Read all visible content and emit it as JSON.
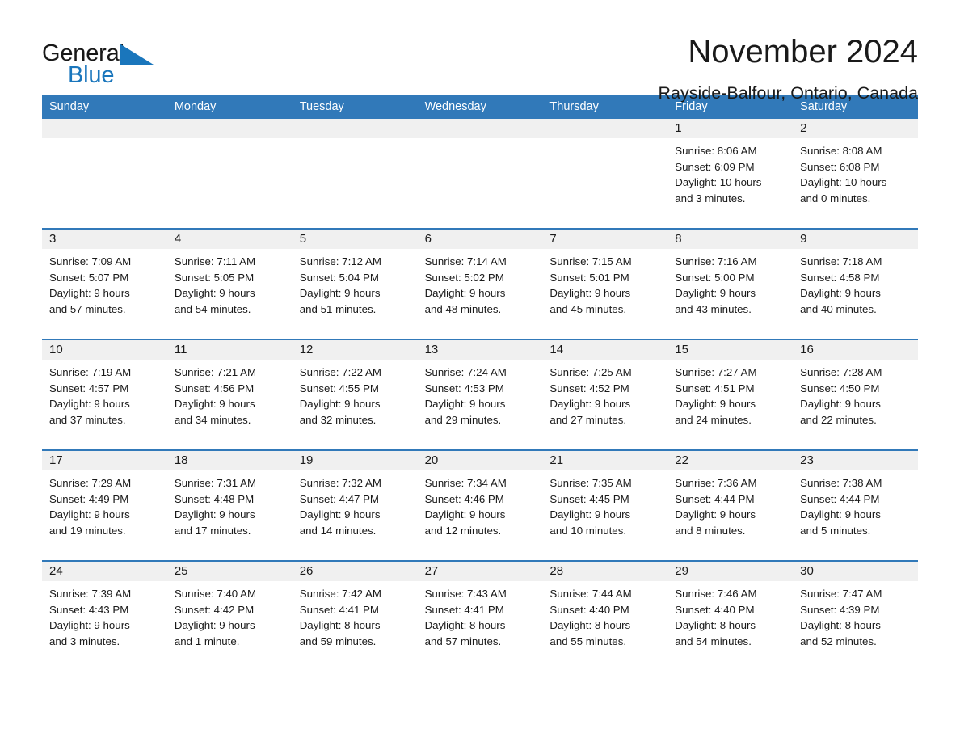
{
  "logo": {
    "word_one": "General",
    "word_two": "Blue",
    "triangle_color": "#1a76bc"
  },
  "header": {
    "month_title": "November 2024",
    "location": "Rayside-Balfour, Ontario, Canada"
  },
  "theme": {
    "header_blue": "#3179b9",
    "daynum_band": "#f0f0f0",
    "text": "#1a1a1a"
  },
  "weekdays": [
    "Sunday",
    "Monday",
    "Tuesday",
    "Wednesday",
    "Thursday",
    "Friday",
    "Saturday"
  ],
  "weeks": [
    [
      {
        "day": "",
        "empty": true
      },
      {
        "day": "",
        "empty": true
      },
      {
        "day": "",
        "empty": true
      },
      {
        "day": "",
        "empty": true
      },
      {
        "day": "",
        "empty": true
      },
      {
        "day": "1",
        "sunrise": "Sunrise: 8:06 AM",
        "sunset": "Sunset: 6:09 PM",
        "daylight_1": "Daylight: 10 hours",
        "daylight_2": "and 3 minutes."
      },
      {
        "day": "2",
        "sunrise": "Sunrise: 8:08 AM",
        "sunset": "Sunset: 6:08 PM",
        "daylight_1": "Daylight: 10 hours",
        "daylight_2": "and 0 minutes."
      }
    ],
    [
      {
        "day": "3",
        "sunrise": "Sunrise: 7:09 AM",
        "sunset": "Sunset: 5:07 PM",
        "daylight_1": "Daylight: 9 hours",
        "daylight_2": "and 57 minutes."
      },
      {
        "day": "4",
        "sunrise": "Sunrise: 7:11 AM",
        "sunset": "Sunset: 5:05 PM",
        "daylight_1": "Daylight: 9 hours",
        "daylight_2": "and 54 minutes."
      },
      {
        "day": "5",
        "sunrise": "Sunrise: 7:12 AM",
        "sunset": "Sunset: 5:04 PM",
        "daylight_1": "Daylight: 9 hours",
        "daylight_2": "and 51 minutes."
      },
      {
        "day": "6",
        "sunrise": "Sunrise: 7:14 AM",
        "sunset": "Sunset: 5:02 PM",
        "daylight_1": "Daylight: 9 hours",
        "daylight_2": "and 48 minutes."
      },
      {
        "day": "7",
        "sunrise": "Sunrise: 7:15 AM",
        "sunset": "Sunset: 5:01 PM",
        "daylight_1": "Daylight: 9 hours",
        "daylight_2": "and 45 minutes."
      },
      {
        "day": "8",
        "sunrise": "Sunrise: 7:16 AM",
        "sunset": "Sunset: 5:00 PM",
        "daylight_1": "Daylight: 9 hours",
        "daylight_2": "and 43 minutes."
      },
      {
        "day": "9",
        "sunrise": "Sunrise: 7:18 AM",
        "sunset": "Sunset: 4:58 PM",
        "daylight_1": "Daylight: 9 hours",
        "daylight_2": "and 40 minutes."
      }
    ],
    [
      {
        "day": "10",
        "sunrise": "Sunrise: 7:19 AM",
        "sunset": "Sunset: 4:57 PM",
        "daylight_1": "Daylight: 9 hours",
        "daylight_2": "and 37 minutes."
      },
      {
        "day": "11",
        "sunrise": "Sunrise: 7:21 AM",
        "sunset": "Sunset: 4:56 PM",
        "daylight_1": "Daylight: 9 hours",
        "daylight_2": "and 34 minutes."
      },
      {
        "day": "12",
        "sunrise": "Sunrise: 7:22 AM",
        "sunset": "Sunset: 4:55 PM",
        "daylight_1": "Daylight: 9 hours",
        "daylight_2": "and 32 minutes."
      },
      {
        "day": "13",
        "sunrise": "Sunrise: 7:24 AM",
        "sunset": "Sunset: 4:53 PM",
        "daylight_1": "Daylight: 9 hours",
        "daylight_2": "and 29 minutes."
      },
      {
        "day": "14",
        "sunrise": "Sunrise: 7:25 AM",
        "sunset": "Sunset: 4:52 PM",
        "daylight_1": "Daylight: 9 hours",
        "daylight_2": "and 27 minutes."
      },
      {
        "day": "15",
        "sunrise": "Sunrise: 7:27 AM",
        "sunset": "Sunset: 4:51 PM",
        "daylight_1": "Daylight: 9 hours",
        "daylight_2": "and 24 minutes."
      },
      {
        "day": "16",
        "sunrise": "Sunrise: 7:28 AM",
        "sunset": "Sunset: 4:50 PM",
        "daylight_1": "Daylight: 9 hours",
        "daylight_2": "and 22 minutes."
      }
    ],
    [
      {
        "day": "17",
        "sunrise": "Sunrise: 7:29 AM",
        "sunset": "Sunset: 4:49 PM",
        "daylight_1": "Daylight: 9 hours",
        "daylight_2": "and 19 minutes."
      },
      {
        "day": "18",
        "sunrise": "Sunrise: 7:31 AM",
        "sunset": "Sunset: 4:48 PM",
        "daylight_1": "Daylight: 9 hours",
        "daylight_2": "and 17 minutes."
      },
      {
        "day": "19",
        "sunrise": "Sunrise: 7:32 AM",
        "sunset": "Sunset: 4:47 PM",
        "daylight_1": "Daylight: 9 hours",
        "daylight_2": "and 14 minutes."
      },
      {
        "day": "20",
        "sunrise": "Sunrise: 7:34 AM",
        "sunset": "Sunset: 4:46 PM",
        "daylight_1": "Daylight: 9 hours",
        "daylight_2": "and 12 minutes."
      },
      {
        "day": "21",
        "sunrise": "Sunrise: 7:35 AM",
        "sunset": "Sunset: 4:45 PM",
        "daylight_1": "Daylight: 9 hours",
        "daylight_2": "and 10 minutes."
      },
      {
        "day": "22",
        "sunrise": "Sunrise: 7:36 AM",
        "sunset": "Sunset: 4:44 PM",
        "daylight_1": "Daylight: 9 hours",
        "daylight_2": "and 8 minutes."
      },
      {
        "day": "23",
        "sunrise": "Sunrise: 7:38 AM",
        "sunset": "Sunset: 4:44 PM",
        "daylight_1": "Daylight: 9 hours",
        "daylight_2": "and 5 minutes."
      }
    ],
    [
      {
        "day": "24",
        "sunrise": "Sunrise: 7:39 AM",
        "sunset": "Sunset: 4:43 PM",
        "daylight_1": "Daylight: 9 hours",
        "daylight_2": "and 3 minutes."
      },
      {
        "day": "25",
        "sunrise": "Sunrise: 7:40 AM",
        "sunset": "Sunset: 4:42 PM",
        "daylight_1": "Daylight: 9 hours",
        "daylight_2": "and 1 minute."
      },
      {
        "day": "26",
        "sunrise": "Sunrise: 7:42 AM",
        "sunset": "Sunset: 4:41 PM",
        "daylight_1": "Daylight: 8 hours",
        "daylight_2": "and 59 minutes."
      },
      {
        "day": "27",
        "sunrise": "Sunrise: 7:43 AM",
        "sunset": "Sunset: 4:41 PM",
        "daylight_1": "Daylight: 8 hours",
        "daylight_2": "and 57 minutes."
      },
      {
        "day": "28",
        "sunrise": "Sunrise: 7:44 AM",
        "sunset": "Sunset: 4:40 PM",
        "daylight_1": "Daylight: 8 hours",
        "daylight_2": "and 55 minutes."
      },
      {
        "day": "29",
        "sunrise": "Sunrise: 7:46 AM",
        "sunset": "Sunset: 4:40 PM",
        "daylight_1": "Daylight: 8 hours",
        "daylight_2": "and 54 minutes."
      },
      {
        "day": "30",
        "sunrise": "Sunrise: 7:47 AM",
        "sunset": "Sunset: 4:39 PM",
        "daylight_1": "Daylight: 8 hours",
        "daylight_2": "and 52 minutes."
      }
    ]
  ]
}
